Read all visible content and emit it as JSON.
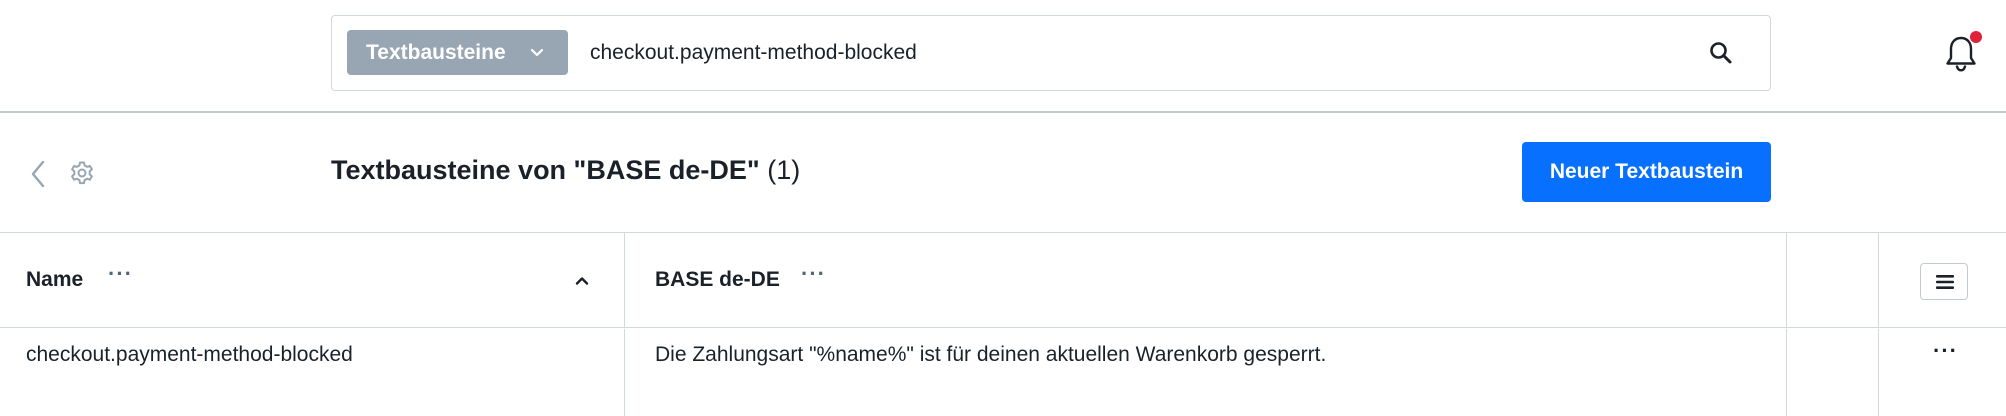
{
  "search": {
    "type_label": "Textbausteine",
    "value": "checkout.payment-method-blocked"
  },
  "header": {
    "title": "Textbausteine von \"BASE de-DE\"",
    "count": "(1)",
    "primary_button": "Neuer Textbaustein"
  },
  "grid": {
    "columns": [
      {
        "label": "Name",
        "dots": "···"
      },
      {
        "label": "BASE de-DE",
        "dots": "···"
      }
    ],
    "rows": [
      {
        "name": "checkout.payment-method-blocked",
        "value": "Die Zahlungsart \"%name%\" ist für deinen aktuellen Warenkorb gesperrt.",
        "actions": "···"
      }
    ]
  },
  "icons": {
    "search": "search-icon",
    "bell": "bell-icon",
    "back": "chevron-left-icon",
    "settings": "gear-icon",
    "sort": "chevron-up-icon",
    "column_settings": "hamburger-icon"
  },
  "colors": {
    "primary": "#0870ff",
    "search_type_bg": "#98a5b3",
    "notification_dot": "#e0213c",
    "border": "#d1d9e0",
    "text": "#1b2129"
  }
}
